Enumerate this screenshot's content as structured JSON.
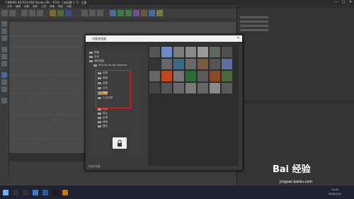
{
  "window": {
    "title": "CINEMA 4D R19.068 Studio (RC - R19) - [未标题 1 *] - 主要",
    "minimize": "—",
    "maximize": "▢",
    "close": "✕"
  },
  "menu": [
    "文件",
    "编辑",
    "创建",
    "选择",
    "工具",
    "网格",
    "捕捉",
    "动画",
    "模拟",
    "渲染",
    "雕刻",
    "运动跟踪",
    "运动图形",
    "角色",
    "流水线",
    "插件",
    "脚本",
    "窗口",
    "帮助"
  ],
  "dialog": {
    "title": "内容浏览器",
    "close": "✕",
    "tree": [
      {
        "label": "预置",
        "indent": 0
      },
      {
        "label": "目录",
        "indent": 0
      },
      {
        "label": "我的电脑",
        "indent": 0
      },
      {
        "label": "MAXON Studio Material",
        "indent": 1
      },
      {
        "label": "材质",
        "indent": 1
      },
      {
        "label": "玻璃",
        "indent": 1
      },
      {
        "label": "金属",
        "indent": 1
      },
      {
        "label": "石材",
        "indent": 1
      },
      {
        "label": "PBR",
        "indent": 2
      },
      {
        "label": "工业材质",
        "indent": 1
      },
      {
        "label": "布料",
        "indent": 1
      },
      {
        "label": "混合",
        "indent": 1
      },
      {
        "label": "皮革",
        "indent": 1
      },
      {
        "label": "其他",
        "indent": 1
      },
      {
        "label": "塑料",
        "indent": 1
      }
    ],
    "status": "内容浏览器"
  },
  "logo": {
    "main": "Bai 经验",
    "sub": "jingyan.baidu.com"
  },
  "taskbar": {
    "time": "11:03",
    "date": "2020/1/10"
  },
  "colors": {
    "accent": "#d22222",
    "dialog_title_bg": "#f2f2f2",
    "taskbar": "#1f2230"
  }
}
